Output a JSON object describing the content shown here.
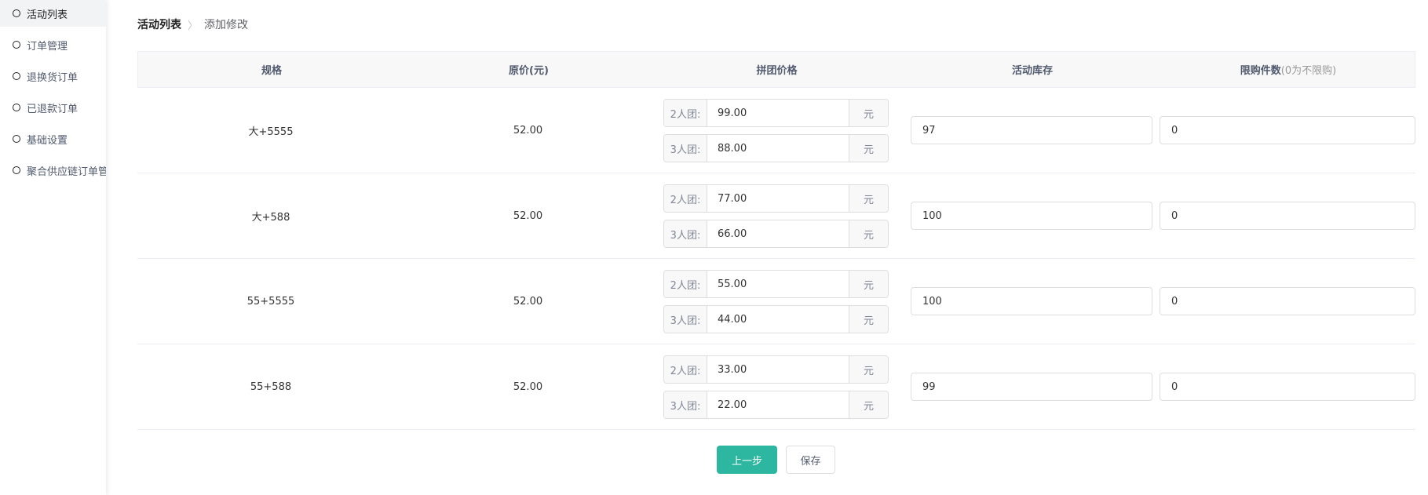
{
  "sidebar": {
    "items": [
      {
        "label": "活动列表",
        "active": true
      },
      {
        "label": "订单管理",
        "active": false
      },
      {
        "label": "退换货订单",
        "active": false
      },
      {
        "label": "已退款订单",
        "active": false
      },
      {
        "label": "基础设置",
        "active": false
      },
      {
        "label": "聚合供应链订单管",
        "active": false
      }
    ]
  },
  "breadcrumb": {
    "root": "活动列表",
    "separator": ">",
    "current": "添加修改"
  },
  "table": {
    "headers": {
      "spec": "规格",
      "original_price": "原价(元)",
      "group_price": "拼团价格",
      "stock": "活动库存",
      "limit": "限购件数",
      "limit_hint": "(0为不限购)"
    },
    "rows": [
      {
        "spec": "大+5555",
        "original_price": "52.00",
        "prices": [
          {
            "label": "2人团:",
            "value": "99.00",
            "unit": "元"
          },
          {
            "label": "3人团:",
            "value": "88.00",
            "unit": "元"
          }
        ],
        "stock": "97",
        "limit": "0"
      },
      {
        "spec": "大+588",
        "original_price": "52.00",
        "prices": [
          {
            "label": "2人团:",
            "value": "77.00",
            "unit": "元"
          },
          {
            "label": "3人团:",
            "value": "66.00",
            "unit": "元"
          }
        ],
        "stock": "100",
        "limit": "0"
      },
      {
        "spec": "55+5555",
        "original_price": "52.00",
        "prices": [
          {
            "label": "2人团:",
            "value": "55.00",
            "unit": "元"
          },
          {
            "label": "3人团:",
            "value": "44.00",
            "unit": "元"
          }
        ],
        "stock": "100",
        "limit": "0"
      },
      {
        "spec": "55+588",
        "original_price": "52.00",
        "prices": [
          {
            "label": "2人团:",
            "value": "33.00",
            "unit": "元"
          },
          {
            "label": "3人团:",
            "value": "22.00",
            "unit": "元"
          }
        ],
        "stock": "99",
        "limit": "0"
      }
    ]
  },
  "actions": {
    "prev_label": "上一步",
    "save_label": "保存"
  },
  "colors": {
    "primary": "#2db7a0",
    "border": "#dcdee2",
    "header_bg": "#f8f8f9"
  }
}
